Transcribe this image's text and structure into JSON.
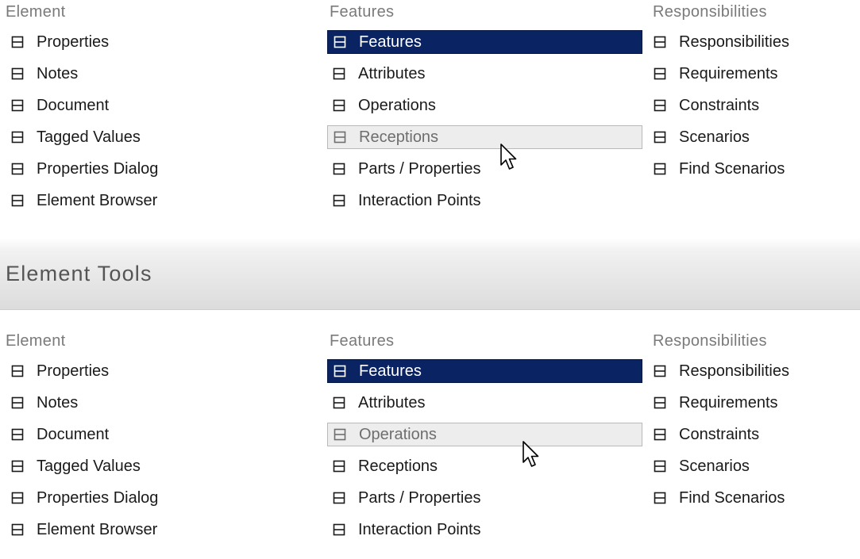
{
  "panels": [
    {
      "columns": [
        {
          "header": "Element",
          "items": [
            {
              "label": "Properties",
              "state": "normal"
            },
            {
              "label": "Notes",
              "state": "normal"
            },
            {
              "label": "Document",
              "state": "normal"
            },
            {
              "label": "Tagged Values",
              "state": "normal"
            },
            {
              "label": "Properties Dialog",
              "state": "normal"
            },
            {
              "label": "Element Browser",
              "state": "normal"
            }
          ]
        },
        {
          "header": "Features",
          "items": [
            {
              "label": "Features",
              "state": "selected"
            },
            {
              "label": "Attributes",
              "state": "normal"
            },
            {
              "label": "Operations",
              "state": "normal"
            },
            {
              "label": "Receptions",
              "state": "hovered"
            },
            {
              "label": "Parts / Properties",
              "state": "normal"
            },
            {
              "label": "Interaction Points",
              "state": "normal"
            }
          ]
        },
        {
          "header": "Responsibilities",
          "items": [
            {
              "label": "Responsibilities",
              "state": "normal"
            },
            {
              "label": "Requirements",
              "state": "normal"
            },
            {
              "label": "Constraints",
              "state": "normal"
            },
            {
              "label": "Scenarios",
              "state": "normal"
            },
            {
              "label": "Find Scenarios",
              "state": "normal"
            }
          ]
        }
      ]
    },
    {
      "columns": [
        {
          "header": "Element",
          "items": [
            {
              "label": "Properties",
              "state": "normal"
            },
            {
              "label": "Notes",
              "state": "normal"
            },
            {
              "label": "Document",
              "state": "normal"
            },
            {
              "label": "Tagged Values",
              "state": "normal"
            },
            {
              "label": "Properties Dialog",
              "state": "normal"
            },
            {
              "label": "Element Browser",
              "state": "normal"
            }
          ]
        },
        {
          "header": "Features",
          "items": [
            {
              "label": "Features",
              "state": "selected"
            },
            {
              "label": "Attributes",
              "state": "normal"
            },
            {
              "label": "Operations",
              "state": "hovered"
            },
            {
              "label": "Receptions",
              "state": "normal"
            },
            {
              "label": "Parts / Properties",
              "state": "normal"
            },
            {
              "label": "Interaction Points",
              "state": "normal"
            }
          ]
        },
        {
          "header": "Responsibilities",
          "items": [
            {
              "label": "Responsibilities",
              "state": "normal"
            },
            {
              "label": "Requirements",
              "state": "normal"
            },
            {
              "label": "Constraints",
              "state": "normal"
            },
            {
              "label": "Scenarios",
              "state": "normal"
            },
            {
              "label": "Find Scenarios",
              "state": "normal"
            }
          ]
        }
      ]
    }
  ],
  "section": {
    "title": "Element Tools"
  },
  "icons": {
    "item_icon": "window-panel-icon",
    "pointer": "mouse-pointer-icon"
  },
  "colors": {
    "selected_bg": "#0a2463",
    "hover_bg": "#ededed",
    "header_text": "#7a7a7a"
  }
}
